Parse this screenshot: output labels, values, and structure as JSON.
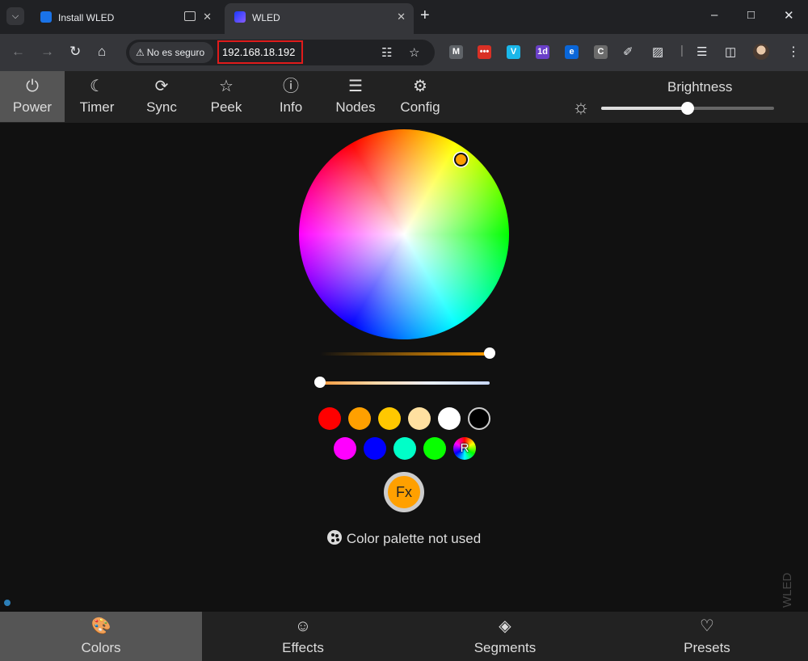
{
  "browser": {
    "tabs": [
      {
        "title": "Install WLED",
        "active": false
      },
      {
        "title": "WLED",
        "active": true
      }
    ],
    "security_label": "No es seguro",
    "url": "192.168.18.192",
    "extensions": [
      {
        "icon": "gmail-icon",
        "text": "M",
        "color": "#5f6368"
      },
      {
        "icon": "red-extension-icon",
        "text": "•••",
        "color": "#d93025"
      },
      {
        "icon": "vimeo-icon",
        "text": "V",
        "color": "#1ab7ea"
      },
      {
        "icon": "calendar-extension-icon",
        "text": "1d",
        "color": "#6a40c8"
      },
      {
        "icon": "edge-extension-icon",
        "text": "e",
        "color": "#0a66d8"
      },
      {
        "icon": "c-extension-icon",
        "text": "C",
        "color": "#6b6b6b"
      }
    ]
  },
  "top_nav": {
    "buttons": [
      {
        "label": "Power",
        "icon": "power-icon",
        "active": true
      },
      {
        "label": "Timer",
        "icon": "moon-icon",
        "active": false
      },
      {
        "label": "Sync",
        "icon": "sync-icon",
        "active": false
      },
      {
        "label": "Peek",
        "icon": "star-icon",
        "active": false
      },
      {
        "label": "Info",
        "icon": "info-icon",
        "active": false
      },
      {
        "label": "Nodes",
        "icon": "list-icon",
        "active": false
      },
      {
        "label": "Config",
        "icon": "gear-icon",
        "active": false
      }
    ],
    "brightness_label": "Brightness",
    "brightness_value": 0.5
  },
  "colors": {
    "picker_color": "#fda000",
    "value_slider": 1.0,
    "kelvin_slider": 0.0,
    "swatches_row1": [
      "#ff0000",
      "#ffa000",
      "#ffc800",
      "#ffe0a0",
      "#ffffff",
      "#000000"
    ],
    "swatches_row2": [
      "#ff00ff",
      "#0000ff",
      "#00ffc8",
      "#08ff00"
    ],
    "random_label": "R",
    "fx_label": "Fx",
    "palette_message": "Color palette not used"
  },
  "brand_vertical": "WLED",
  "bottom_nav": {
    "buttons": [
      {
        "label": "Colors",
        "icon": "palette-icon",
        "active": true
      },
      {
        "label": "Effects",
        "icon": "smiley-icon",
        "active": false
      },
      {
        "label": "Segments",
        "icon": "layers-icon",
        "active": false
      },
      {
        "label": "Presets",
        "icon": "heart-icon",
        "active": false
      }
    ]
  }
}
